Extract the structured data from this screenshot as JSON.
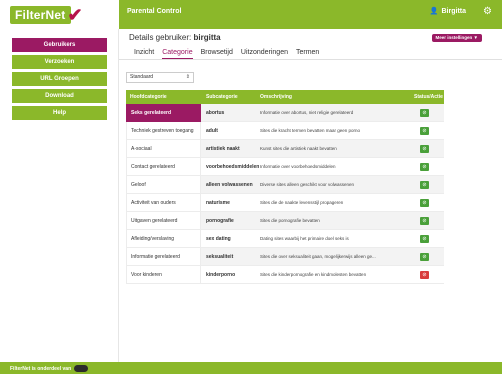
{
  "app": {
    "logo_text": "FilterNet",
    "title": "Parental Control",
    "user": "Birgitta"
  },
  "sidebar": {
    "items": [
      {
        "label": "Gebruikers",
        "active": true
      },
      {
        "label": "Verzoeken",
        "active": false
      },
      {
        "label": "URL Groepen",
        "active": false
      },
      {
        "label": "Download",
        "active": false
      },
      {
        "label": "Help",
        "active": false
      }
    ]
  },
  "footer": {
    "text": "FilterNet is onderdeel van"
  },
  "content": {
    "details_prefix": "Details gebruiker: ",
    "details_user": "birgitta",
    "more_settings": "Meer instellingen ▼",
    "tabs": [
      {
        "label": "Inzicht",
        "active": false
      },
      {
        "label": "Categorie",
        "active": true
      },
      {
        "label": "Browsetijd",
        "active": false
      },
      {
        "label": "Uitzonderingen",
        "active": false
      },
      {
        "label": "Termen",
        "active": false
      }
    ],
    "select_value": "Standaard",
    "table": {
      "headers": [
        "Hoofdcategorie",
        "Subcategorie",
        "Omschrijving",
        "Status/Actie"
      ],
      "categories": [
        {
          "label": "Seks gerelateerd",
          "active": true
        },
        {
          "label": "Techniek gestreven toegang",
          "active": false
        },
        {
          "label": "A-sociaal",
          "active": false
        },
        {
          "label": "Contact gerelateerd",
          "active": false
        },
        {
          "label": "Geloof",
          "active": false
        },
        {
          "label": "Activiteit van ouders",
          "active": false
        },
        {
          "label": "Uitgaven gerelateerd",
          "active": false
        },
        {
          "label": "Afleiding/verslaving",
          "active": false
        },
        {
          "label": "Informatie gerelateerd",
          "active": false
        },
        {
          "label": "Voor kinderen",
          "active": false
        }
      ],
      "rows": [
        {
          "sub": "abortus",
          "desc": "Informatie over abortus, niet religie gerelateerd",
          "status": "allowed"
        },
        {
          "sub": "adult",
          "desc": "Sites die kracht termen bevatten maar geen porno",
          "status": "allowed"
        },
        {
          "sub": "artistiek naakt",
          "desc": "Kunst sites die artistiek naakt bevatten",
          "status": "allowed"
        },
        {
          "sub": "voorbehoedsmiddelen",
          "desc": "Informatie over voorbehoedsmiddelen",
          "status": "allowed"
        },
        {
          "sub": "alleen volwassenen",
          "desc": "Diverse sites alleen geschikt voor volwassenen",
          "status": "allowed"
        },
        {
          "sub": "naturisme",
          "desc": "Sites die de naakte levensstijl propageren",
          "status": "allowed"
        },
        {
          "sub": "pornografie",
          "desc": "Sites die pornografie bevatten",
          "status": "allowed"
        },
        {
          "sub": "sex dating",
          "desc": "Dating sites waarbij het primaire doel seks is",
          "status": "allowed"
        },
        {
          "sub": "seksualiteit",
          "desc": "Sites die over seksualiteit gaan, mogelijkerwijs alleen ge...",
          "status": "allowed"
        },
        {
          "sub": "kinderporno",
          "desc": "Sites die kinderpornografie en kindmolesten bevatten",
          "status": "blocked"
        }
      ]
    }
  },
  "colors": {
    "green": "#8bb82a",
    "purple": "#9b1a63",
    "allowed": "#4aa03a",
    "blocked": "#d83c3c"
  }
}
